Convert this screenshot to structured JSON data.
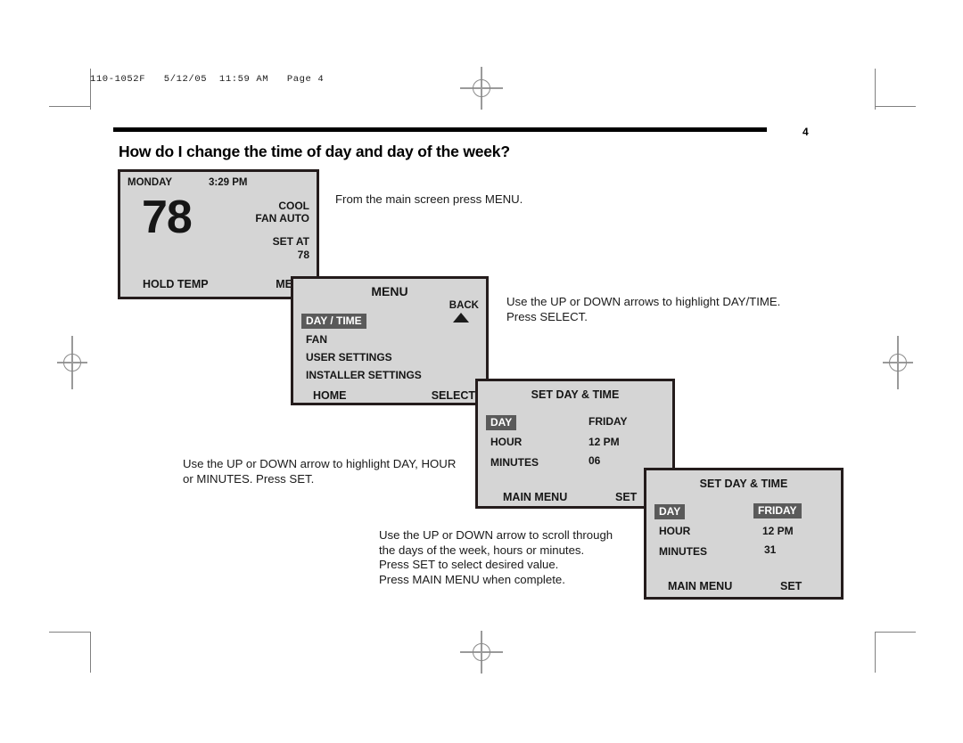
{
  "document": {
    "file_stamp": "110-1052F   5/12/05  11:59 AM   Page 4",
    "page_number": "4",
    "title": "How do I change the time of day and day of the week?"
  },
  "instructions": [
    {
      "id": "instr-1",
      "text": "From the main screen press MENU."
    },
    {
      "id": "instr-2",
      "text": "Use the UP or DOWN arrows to highlight DAY/TIME.\nPress SELECT."
    },
    {
      "id": "instr-3",
      "text": "Use the UP or DOWN arrow to highlight DAY, HOUR\nor MINUTES. Press SET."
    },
    {
      "id": "instr-4",
      "text": "Use the UP or DOWN arrow to scroll through\nthe days of the week, hours or minutes.\nPress SET to select desired value.\nPress MAIN MENU when complete."
    }
  ],
  "screens": {
    "main": {
      "day": "MONDAY",
      "time": "3:29 PM",
      "temperature": "78",
      "mode": "COOL",
      "fan": "FAN AUTO",
      "set_at_label": "SET AT",
      "set_at_value": "78",
      "left_button": "HOLD TEMP",
      "right_button": "MENU"
    },
    "menu": {
      "title": "MENU",
      "back_label": "BACK",
      "items": [
        {
          "label": "DAY / TIME",
          "highlighted": true
        },
        {
          "label": "FAN",
          "highlighted": false
        },
        {
          "label": "USER SETTINGS",
          "highlighted": false
        },
        {
          "label": "INSTALLER SETTINGS",
          "highlighted": false
        }
      ],
      "left_button": "HOME",
      "right_button": "SELECT"
    },
    "set_day_time_1": {
      "title": "SET DAY & TIME",
      "rows": [
        {
          "label": "DAY",
          "value": "FRIDAY",
          "label_highlighted": true,
          "value_highlighted": false
        },
        {
          "label": "HOUR",
          "value": "12 PM",
          "label_highlighted": false,
          "value_highlighted": false
        },
        {
          "label": "MINUTES",
          "value": "06",
          "label_highlighted": false,
          "value_highlighted": false
        }
      ],
      "left_button": "MAIN MENU",
      "right_button": "SET"
    },
    "set_day_time_2": {
      "title": "SET DAY & TIME",
      "rows": [
        {
          "label": "DAY",
          "value": "FRIDAY",
          "label_highlighted": true,
          "value_highlighted": true
        },
        {
          "label": "HOUR",
          "value": "12 PM",
          "label_highlighted": false,
          "value_highlighted": false
        },
        {
          "label": "MINUTES",
          "value": "31",
          "label_highlighted": false,
          "value_highlighted": false
        }
      ],
      "left_button": "MAIN MENU",
      "right_button": "SET"
    }
  },
  "colors": {
    "lcd_background": "#d5d5d5",
    "lcd_border": "#241c1c",
    "highlight": "#5a5a5a",
    "highlight_text": "#ffffff",
    "rule": "#000000"
  }
}
